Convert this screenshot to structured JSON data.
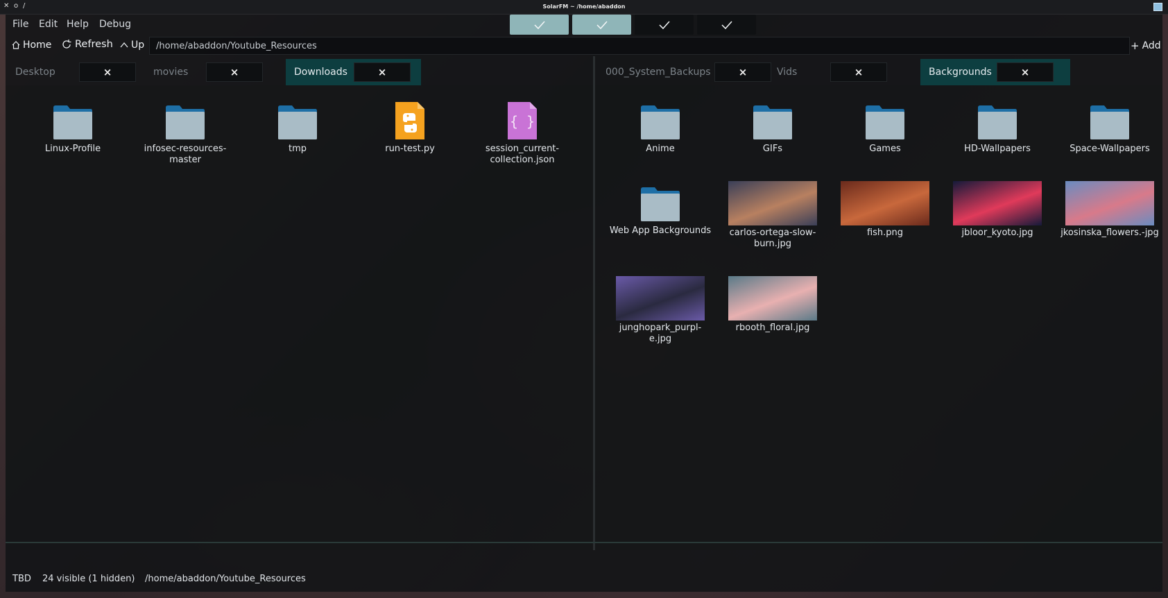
{
  "titlebar": {
    "title": "SolarFM ~ /home/abaddon",
    "controls": [
      "✕",
      "o",
      "/"
    ]
  },
  "menu": {
    "file": "File",
    "edit": "Edit",
    "help": "Help",
    "debug": "Debug"
  },
  "view_toggles": [
    {
      "icon": "check-icon",
      "active": true
    },
    {
      "icon": "check-icon",
      "active": true
    },
    {
      "icon": "check-icon",
      "active": false
    },
    {
      "icon": "check-icon",
      "active": false
    }
  ],
  "toolbar": {
    "home": "Home",
    "refresh": "Refresh",
    "up": "Up",
    "path": "/home/abaddon/Youtube_Resources",
    "add": "Add"
  },
  "left_pane": {
    "tabs": [
      {
        "label": "Desktop",
        "close": "×",
        "active": false
      },
      {
        "label": "movies",
        "close": "×",
        "active": false
      },
      {
        "label": "Downloads",
        "close": "×",
        "active": true
      }
    ],
    "items": [
      {
        "name": "Linux-Profile",
        "kind": "folder"
      },
      {
        "name": "infosec-resources-master",
        "kind": "folder"
      },
      {
        "name": "tmp",
        "kind": "folder"
      },
      {
        "name": "run-test.py",
        "kind": "python"
      },
      {
        "name": "session_current-collection.json",
        "kind": "json"
      }
    ]
  },
  "right_pane": {
    "tabs": [
      {
        "label": "000_System_Backups",
        "close": "×",
        "active": false
      },
      {
        "label": "Vids",
        "close": "×",
        "active": false
      },
      {
        "label": "Backgrounds",
        "close": "×",
        "active": true
      }
    ],
    "items": [
      {
        "name": "Anime",
        "kind": "folder"
      },
      {
        "name": "GIFs",
        "kind": "folder"
      },
      {
        "name": "Games",
        "kind": "folder"
      },
      {
        "name": "HD-Wallpapers",
        "kind": "folder"
      },
      {
        "name": "Space-Wallpapers",
        "kind": "folder"
      },
      {
        "name": "Web App Backgrounds",
        "kind": "folder"
      },
      {
        "name": "carlos-ortega-slow-burn.jpg",
        "kind": "image",
        "colors": [
          "#3a3f58",
          "#b88060"
        ]
      },
      {
        "name": "fish.png",
        "kind": "image",
        "colors": [
          "#6a2a1c",
          "#c8683c"
        ]
      },
      {
        "name": "jbloor_kyoto.jpg",
        "kind": "image",
        "colors": [
          "#151a3a",
          "#e03a5a"
        ]
      },
      {
        "name": "jkosinska_flowers.-jpg",
        "kind": "image",
        "colors": [
          "#6a8cc0",
          "#d87a8a"
        ]
      },
      {
        "name": "junghopark_purpl-e.jpg",
        "kind": "image",
        "colors": [
          "#6a5aa8",
          "#2a2a40"
        ]
      },
      {
        "name": "rbooth_floral.jpg",
        "kind": "image",
        "colors": [
          "#5a7a88",
          "#e8b0b0"
        ]
      }
    ]
  },
  "status": {
    "left": "TBD",
    "count": "24 visible (1 hidden)",
    "path": "/home/abaddon/Youtube_Resources"
  },
  "colors": {
    "folder_body": "#a9bcc6",
    "folder_tab": "#1e6fa6",
    "accent_tab": "#0d3e40"
  }
}
